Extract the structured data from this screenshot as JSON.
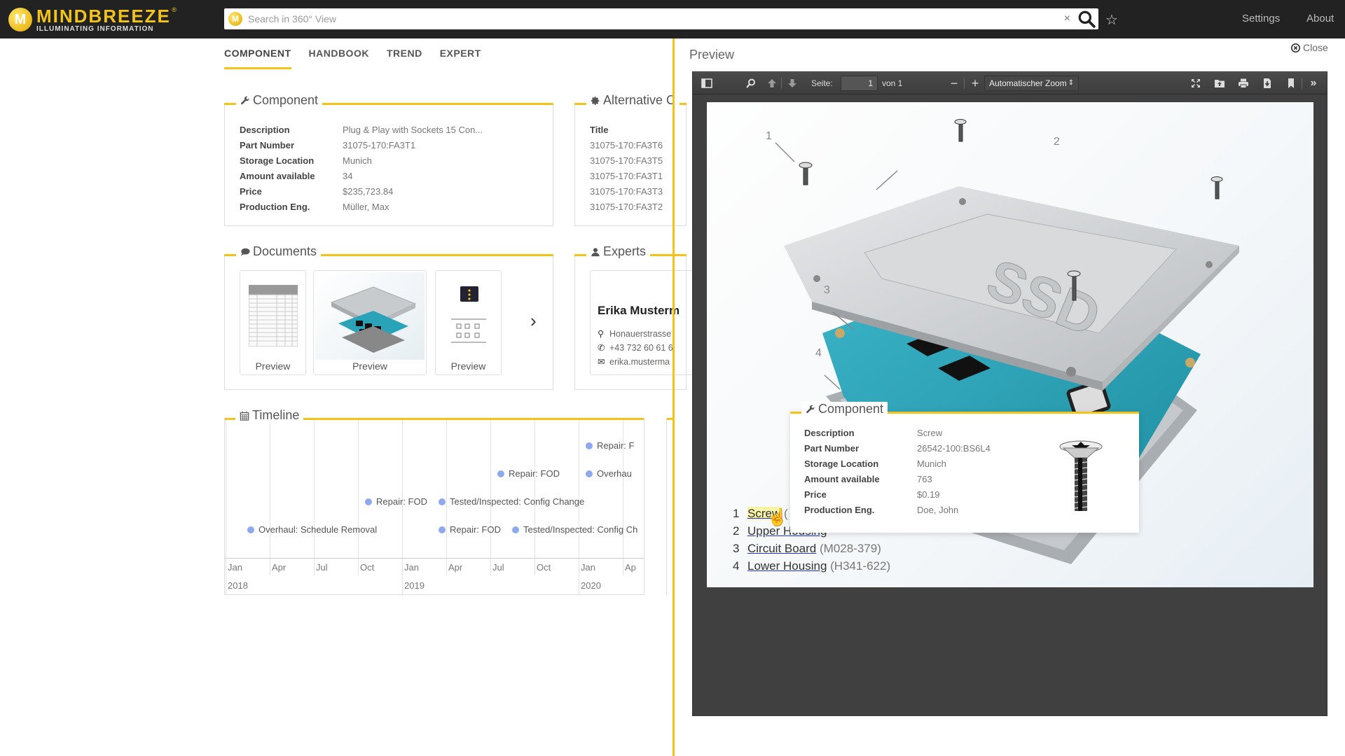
{
  "header": {
    "logo_title": "MINDBREEZE",
    "logo_subtitle": "ILLUMINATING INFORMATION",
    "logo_reg": "®",
    "search_placeholder": "Search in 360° View",
    "clear_icon": "×",
    "nav": [
      {
        "label": "Settings"
      },
      {
        "label": "About"
      }
    ]
  },
  "tabs": [
    {
      "label": "COMPONENT",
      "active": true
    },
    {
      "label": "HANDBOOK",
      "active": false
    },
    {
      "label": "TREND",
      "active": false
    },
    {
      "label": "EXPERT",
      "active": false
    }
  ],
  "component": {
    "title": "Component",
    "icon": "wrench-icon",
    "rows": [
      {
        "key": "Description",
        "value": "Plug & Play with Sockets 15 Con..."
      },
      {
        "key": "Part Number",
        "value": "31075-170:FA3T1"
      },
      {
        "key": "Storage Location",
        "value": "Munich"
      },
      {
        "key": "Amount available",
        "value": "34"
      },
      {
        "key": "Price",
        "value": "$235,723.84"
      },
      {
        "key": "Production Eng.",
        "value": "Müller, Max"
      }
    ]
  },
  "alternative": {
    "title": "Alternative C",
    "icon": "gear-icon",
    "header": "Title",
    "items": [
      "31075-170:FA3T6",
      "31075-170:FA3T5",
      "31075-170:FA3T1",
      "31075-170:FA3T3",
      "31075-170:FA3T2"
    ]
  },
  "documents": {
    "title": "Documents",
    "icon": "comment-icon",
    "items": [
      {
        "label": "Preview",
        "type": "table-document"
      },
      {
        "label": "Preview",
        "type": "ssd-exploded-image"
      },
      {
        "label": "Preview",
        "type": "server-diagram"
      }
    ],
    "next_icon": "›"
  },
  "experts": {
    "title": "Experts",
    "icon": "user-icon",
    "name": "Erika Musterm",
    "address": "Honauerstrasse",
    "phone": "+43 732 60 61 6",
    "email": "erika.musterma"
  },
  "timeline": {
    "title": "Timeline",
    "icon": "calendar-icon",
    "months": [
      "Jan",
      "Apr",
      "Jul",
      "Oct",
      "Jan",
      "Apr",
      "Jul",
      "Oct",
      "Jan",
      "Ap"
    ],
    "years": [
      "2018",
      "2019",
      "2020"
    ],
    "events": [
      {
        "label": "Repair: F",
        "date": "2020-01"
      },
      {
        "label": "Repair: FOD",
        "date": "2019-07"
      },
      {
        "label": "Overhau",
        "date": "2020-01"
      },
      {
        "label": "Repair: FOD",
        "date": "2018-10"
      },
      {
        "label": "Tested/Inspected: Config Change",
        "date": "2019-03"
      },
      {
        "label": "Overhaul: Schedule Removal",
        "date": "2018-02"
      },
      {
        "label": "Repair: FOD",
        "date": "2019-03"
      },
      {
        "label": "Tested/Inspected: Config Ch",
        "date": "2019-08"
      }
    ]
  },
  "preview": {
    "title": "Preview",
    "close_label": "Close",
    "toolbar": {
      "page_label": "Seite:",
      "page_value": "1",
      "page_total": "von 1",
      "zoom_value": "Automatischer Zoom"
    },
    "callouts": [
      "1",
      "2",
      "3",
      "4"
    ],
    "parts": [
      {
        "num": "1",
        "name": "Screw",
        "code": "(",
        "highlighted": true
      },
      {
        "num": "2",
        "name": "Upper Housing",
        "code": ""
      },
      {
        "num": "3",
        "name": "Circuit Board",
        "code": "(M028-379)"
      },
      {
        "num": "4",
        "name": "Lower Housing",
        "code": "(H341-622)"
      }
    ]
  },
  "popup": {
    "title": "Component",
    "rows": [
      {
        "key": "Description",
        "value": "Screw"
      },
      {
        "key": "Part Number",
        "value": "26542-100:BS6L4"
      },
      {
        "key": "Storage Location",
        "value": "Munich"
      },
      {
        "key": "Amount available",
        "value": "763"
      },
      {
        "key": "Price",
        "value": "$0.19"
      },
      {
        "key": "Production Eng.",
        "value": "Doe, John"
      }
    ]
  },
  "colors": {
    "accent": "#f2c318",
    "topbar": "#222222",
    "timeline_dot": "#8fa9ef",
    "link_underline": "#2233cc"
  }
}
